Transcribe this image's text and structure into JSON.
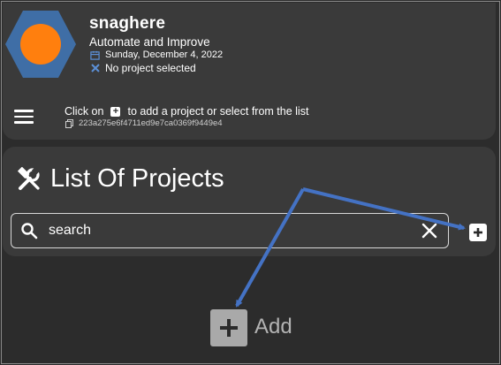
{
  "app": {
    "name": "snaghere",
    "tagline": "Automate and Improve",
    "date": "Sunday, December 4, 2022",
    "project_status": "No project selected",
    "logo_colors": {
      "hexagon": "#3f6ea6",
      "circle": "#ff7f0e"
    }
  },
  "hint": {
    "prefix": "Click on",
    "suffix": "to add a project or select from the list",
    "plus_glyph": "+",
    "id": "223a275e6f4711ed9e7ca0369f9449e4"
  },
  "projects": {
    "title": "List Of Projects",
    "search_value": "search",
    "add_label": "Add"
  },
  "icons": {
    "menu": "menu-icon",
    "calendar": "calendar-icon",
    "tools": "tools-icon",
    "copy": "copy-icon",
    "search": "search-icon",
    "clear": "close-icon",
    "add": "plus-icon"
  },
  "annotation_color": "#4472c4"
}
